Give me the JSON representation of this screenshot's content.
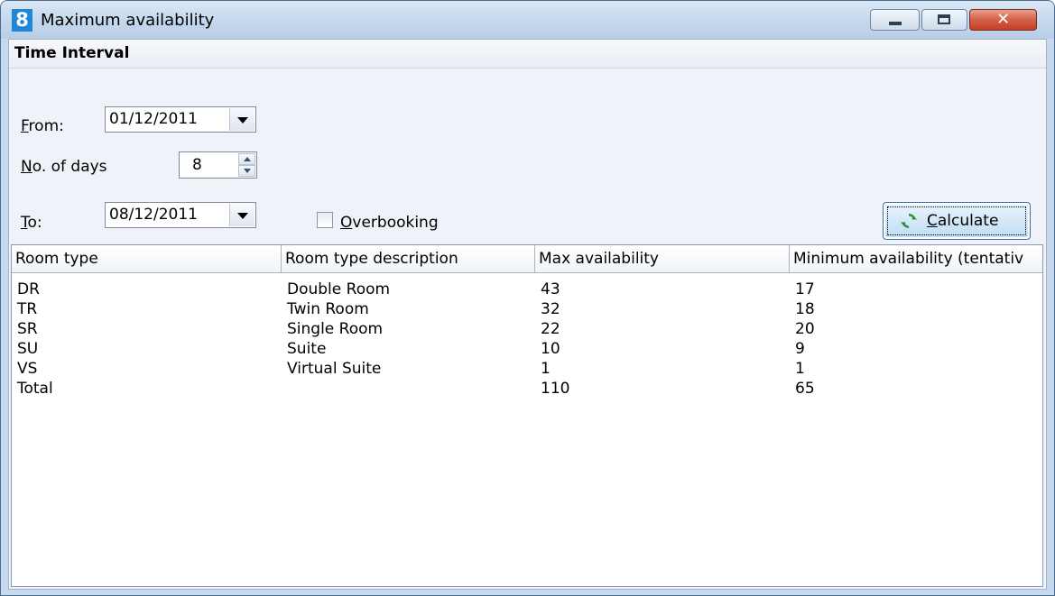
{
  "window": {
    "title": "Maximum availability",
    "app_icon_glyph": "8",
    "controls": {
      "minimize": "minimize-icon",
      "maximize": "maximize-icon",
      "close_glyph": "✕"
    }
  },
  "time_interval": {
    "title": "Time Interval",
    "from_label": "From:",
    "from_value": "01/12/2011",
    "days_label": "No. of days",
    "days_value": "8",
    "to_label": "To:",
    "to_value": "08/12/2011",
    "overbooking_label": "Overbooking",
    "overbooking_checked": false,
    "calculate_label": "Calculate"
  },
  "table": {
    "columns": [
      "Room type",
      "Room type description",
      "Max availability",
      "Minimum availability (tentativ"
    ],
    "rows": [
      [
        "DR",
        "Double Room",
        "43",
        "17"
      ],
      [
        "TR",
        "Twin Room",
        "32",
        "18"
      ],
      [
        "SR",
        "Single Room",
        "22",
        "20"
      ],
      [
        "SU",
        "Suite",
        "10",
        "9"
      ],
      [
        "VS",
        "Virtual Suite",
        "1",
        "1"
      ],
      [
        "Total",
        "",
        "110",
        "65"
      ]
    ]
  },
  "colors": {
    "accent": "#1e88d6",
    "close": "#c43f25",
    "refresh_icon": "#2e8b2e"
  }
}
